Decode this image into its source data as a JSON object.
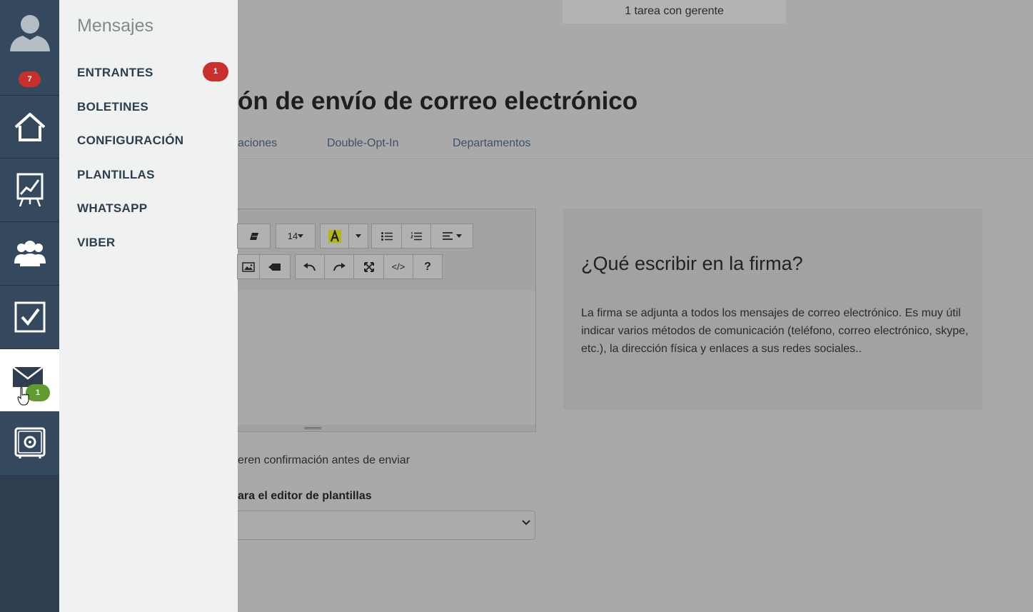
{
  "sidebar": {
    "notifications_badge": "7",
    "mail_badge": "1",
    "icons": [
      "user-avatar-icon",
      "home-icon",
      "chart-icon",
      "people-icon",
      "checkbox-icon",
      "envelope-icon",
      "safe-icon"
    ]
  },
  "flyout": {
    "title": "Mensajes",
    "items": [
      {
        "label": "ENTRANTES",
        "badge": "1"
      },
      {
        "label": "BOLETINES"
      },
      {
        "label": "CONFIGURACIÓN"
      },
      {
        "label": "PLANTILLAS"
      },
      {
        "label": "WHATSAPP"
      },
      {
        "label": "VIBER"
      }
    ]
  },
  "header": {
    "task_strip": "1 tarea con gerente"
  },
  "main": {
    "title": "ón de envío de correo electrónico",
    "tabs": [
      "aciones",
      "Double-Opt-In",
      "Departamentos"
    ],
    "editor": {
      "font_size": "14",
      "help_label": "?",
      "code_label": "</>"
    },
    "confirm_text": "eren confirmación antes de enviar",
    "select_label": "ara el editor de plantillas"
  },
  "info": {
    "title": "¿Qué escribir en la firma?",
    "text": "La firma se adjunta a todos los mensajes de correo electrónico. Es muy útil indicar varios métodos de comunicación (teléfono, correo electrónico, skype, etc.), la dirección física y enlaces a sus redes sociales.."
  },
  "colors": {
    "rail": "#34495e",
    "flyout": "#f0f1f1",
    "badge_red": "#c9302c",
    "badge_green": "#5f9b2e"
  }
}
